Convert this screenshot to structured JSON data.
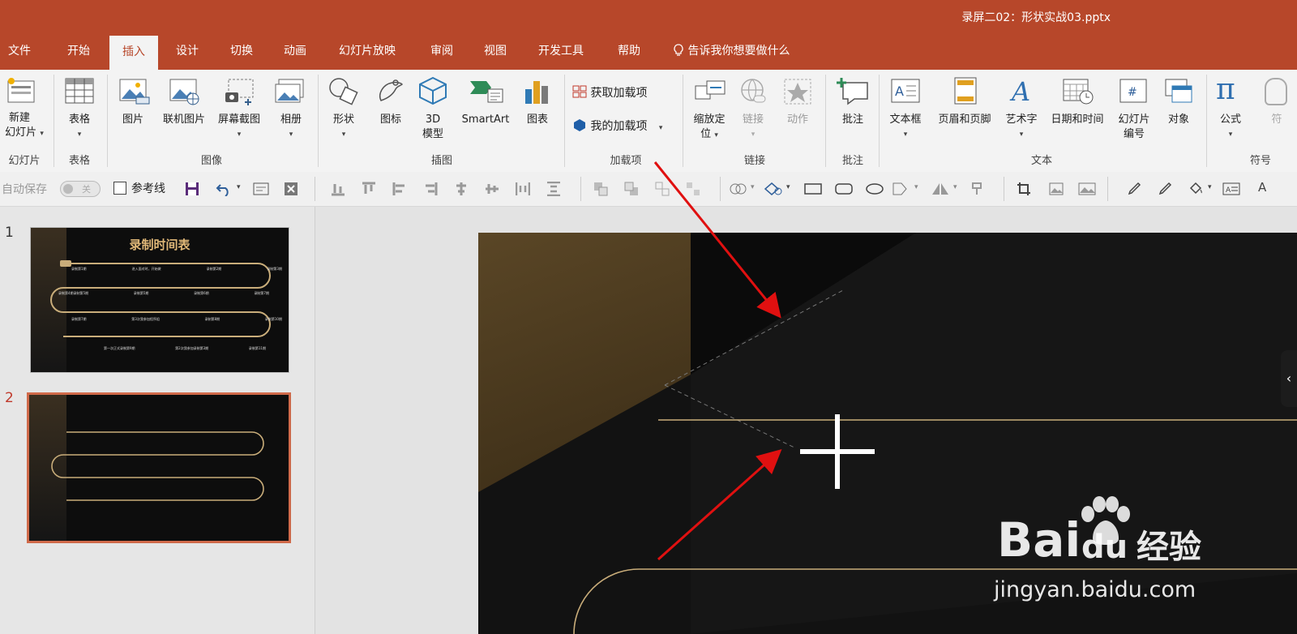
{
  "window": {
    "title": "录屏二02：形状实战03.pptx"
  },
  "tabs": [
    "文件",
    "开始",
    "插入",
    "设计",
    "切换",
    "动画",
    "幻灯片放映",
    "审阅",
    "视图",
    "开发工具",
    "帮助"
  ],
  "active_tab": "插入",
  "tell_me": "告诉我你想要做什么",
  "ribbon": {
    "new_slide": [
      "新建",
      "幻灯片"
    ],
    "table": "表格",
    "picture": "图片",
    "online_picture": "联机图片",
    "screenshot": "屏幕截图",
    "album": "相册",
    "shapes": "形状",
    "icons": "图标",
    "model3d": [
      "3D",
      "模型"
    ],
    "smartart": "SmartArt",
    "chart": "图表",
    "get_addins": "获取加载项",
    "my_addins": "我的加载项",
    "zoom": [
      "缩放定",
      "位"
    ],
    "link": "链接",
    "action": "动作",
    "comment": "批注",
    "textbox": "文本框",
    "header_footer": "页眉和页脚",
    "wordart": "艺术字",
    "datetime": "日期和时间",
    "slide_number": [
      "幻灯片",
      "编号"
    ],
    "object": "对象",
    "equation": "公式",
    "symbol_partial": "符",
    "groups": {
      "slides": "幻灯片",
      "tables": "表格",
      "images": "图像",
      "illustrations": "插图",
      "addins": "加载项",
      "links": "链接",
      "comments": "批注",
      "text": "文本",
      "symbols": "符号"
    }
  },
  "qat": {
    "autosave": "自动保存",
    "autosave_state": "关",
    "guides": "参考线"
  },
  "slides": [
    {
      "number": "1",
      "title": "录制时间表",
      "rows": [
        [
          "录制第1期",
          "进入面对时，开始做",
          "录制第2期",
          "录制第3期"
        ],
        [
          "录制第4期录制第5期",
          "录制第5期",
          "录制第6期",
          "录制第7期"
        ],
        [
          "录制第7期",
          "第3次我参加程序组",
          "录制第8期",
          "录制第10期"
        ],
        [
          "第一次正式录制第9期",
          "第2次我参加录制第3期",
          "录制第11期"
        ]
      ]
    },
    {
      "number": "2"
    }
  ],
  "watermark": {
    "brand": "Bai",
    "brand2": "du",
    "cn": "经验",
    "url": "jingyan.baidu.com"
  },
  "colors": {
    "brand": "#b7472a",
    "gold": "#c9ad7a",
    "arrow": "#e01010",
    "ribbon_bg": "#f3f3f3"
  }
}
